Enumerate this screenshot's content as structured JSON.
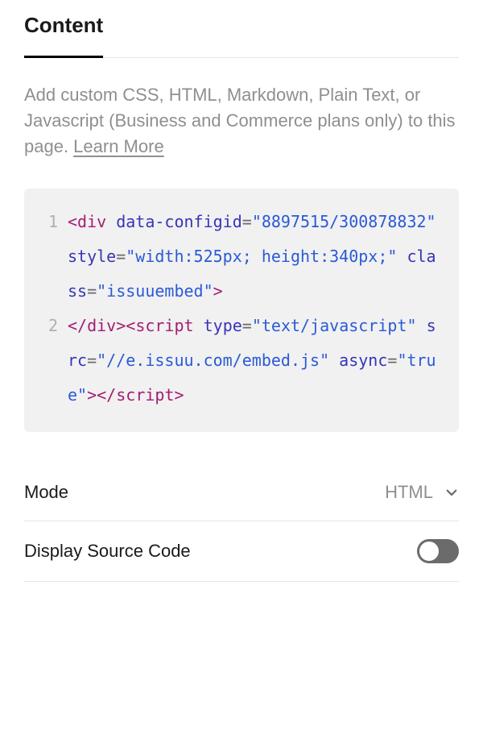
{
  "tab": {
    "label": "Content"
  },
  "help": {
    "text": "Add custom CSS, HTML, Markdown, Plain Text, or Javascript (Business and Commerce plans only) to this page. ",
    "learn_more": "Learn More"
  },
  "code": {
    "lines": [
      {
        "num": "1",
        "tokens": [
          {
            "t": "<",
            "c": "p-tag"
          },
          {
            "t": "div",
            "c": "p-elem"
          },
          {
            "t": " ",
            "c": ""
          },
          {
            "t": "data-configid",
            "c": "p-attr"
          },
          {
            "t": "=",
            "c": "p-eq"
          },
          {
            "t": "\"8897515/300878832\"",
            "c": "p-str"
          },
          {
            "t": " ",
            "c": ""
          },
          {
            "t": "style",
            "c": "p-attr"
          },
          {
            "t": "=",
            "c": "p-eq"
          },
          {
            "t": "\"width:525px; height:340px;\"",
            "c": "p-str"
          },
          {
            "t": " ",
            "c": ""
          },
          {
            "t": "class",
            "c": "p-attr"
          },
          {
            "t": "=",
            "c": "p-eq"
          },
          {
            "t": "\"issuuembed\"",
            "c": "p-str"
          },
          {
            "t": ">",
            "c": "p-tag"
          }
        ]
      },
      {
        "num": "2",
        "tokens": [
          {
            "t": "</",
            "c": "p-tag"
          },
          {
            "t": "div",
            "c": "p-elem"
          },
          {
            "t": ">",
            "c": "p-tag"
          },
          {
            "t": "<",
            "c": "p-tag"
          },
          {
            "t": "script",
            "c": "p-tag"
          },
          {
            "t": " ",
            "c": ""
          },
          {
            "t": "type",
            "c": "p-attr"
          },
          {
            "t": "=",
            "c": "p-eq"
          },
          {
            "t": "\"text/javascript\"",
            "c": "p-str"
          },
          {
            "t": " ",
            "c": ""
          },
          {
            "t": "src",
            "c": "p-attr"
          },
          {
            "t": "=",
            "c": "p-eq"
          },
          {
            "t": "\"//e.issuu.com/embed.js\"",
            "c": "p-str"
          },
          {
            "t": " ",
            "c": ""
          },
          {
            "t": "async",
            "c": "p-attr"
          },
          {
            "t": "=",
            "c": "p-eq"
          },
          {
            "t": "\"true\"",
            "c": "p-str"
          },
          {
            "t": ">",
            "c": "p-tag"
          },
          {
            "t": "</",
            "c": "p-tag"
          },
          {
            "t": "script",
            "c": "p-tag"
          },
          {
            "t": ">",
            "c": "p-tag"
          }
        ]
      }
    ]
  },
  "settings": {
    "mode": {
      "label": "Mode",
      "value": "HTML"
    },
    "display_source": {
      "label": "Display Source Code",
      "on": false
    }
  }
}
